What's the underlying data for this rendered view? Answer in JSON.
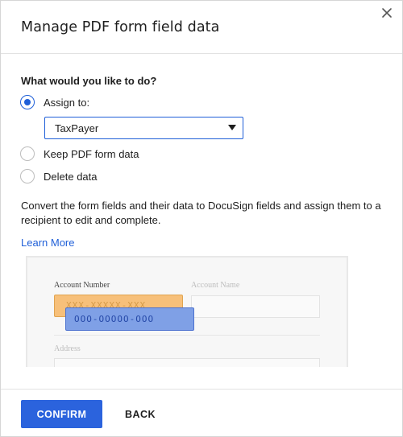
{
  "dialog": {
    "title": "Manage PDF form field data",
    "close_icon": "close-icon"
  },
  "question": "What would you like to do?",
  "options": [
    {
      "label": "Assign to:",
      "selected": true
    },
    {
      "label": "Keep PDF form data",
      "selected": false
    },
    {
      "label": "Delete data",
      "selected": false
    }
  ],
  "recipient_select": {
    "value": "TaxPayer",
    "caret_icon": "caret-down-icon"
  },
  "description": "Convert the form fields and their data to DocuSign fields and assign them to a recipient to edit and complete.",
  "learn_more": "Learn More",
  "illustration": {
    "account_number_label": "Account Number",
    "account_name_label": "Account Name",
    "address_label": "Address",
    "pdf_field_placeholder": "XXX-XXXXX-XXX",
    "docusign_field_placeholder": "OOO-OOOOO-OOO"
  },
  "footer": {
    "confirm_label": "CONFIRM",
    "back_label": "BACK"
  },
  "colors": {
    "accent": "#2b63dd",
    "link": "#1f5fd8",
    "pdf_field": "#f7c07a",
    "docusign_field": "#7fa0e6"
  }
}
